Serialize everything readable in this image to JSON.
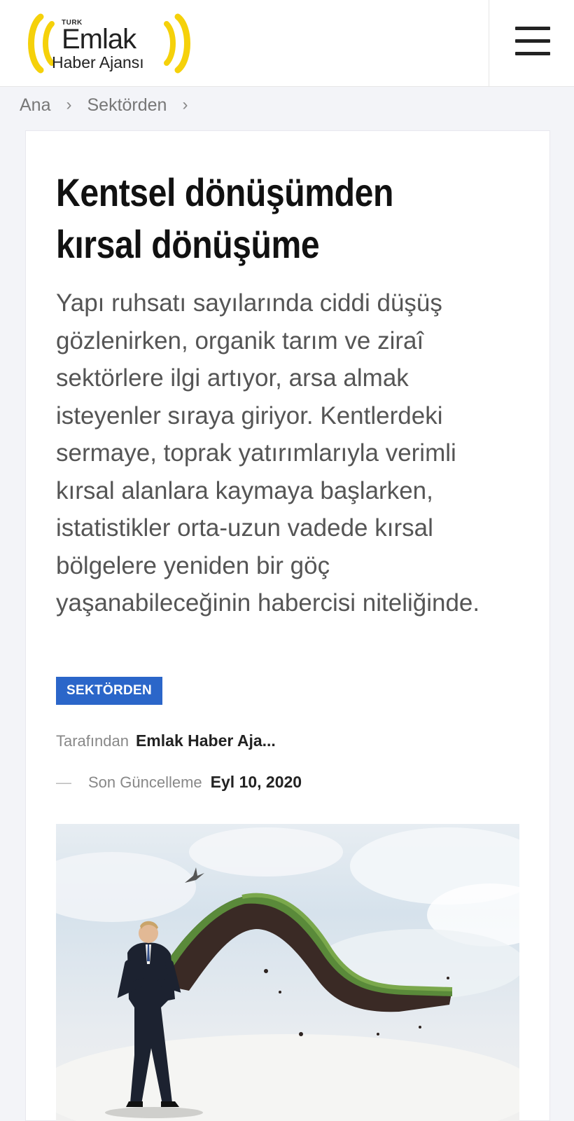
{
  "header": {
    "logo": {
      "turk": "TURK",
      "emlak": "Emlak",
      "haber_ajansi": "Haber Ajansı",
      "accent_color": "#f5d10a"
    },
    "menu_icon": "hamburger-menu-icon"
  },
  "breadcrumb": {
    "items": [
      "Ana",
      "Sektörden"
    ],
    "separator_icon": "chevron-right-icon"
  },
  "article": {
    "title": "Kentsel dönüşümden kırsal dönüşüme",
    "lead": "Yapı ruhsatı sayılarında ciddi düşüş gözlenirken, organik tarım ve ziraî sektörlere ilgi artıyor, arsa almak isteyenler sıraya giriyor. Kentlerdeki sermaye, toprak yatırımlarıyla verimli kırsal alanlara kaymaya başlarken, istatistikler orta-uzun vadede kırsal bölgelere yeniden bir göç yaşanabileceğinin habercisi niteliğinde.",
    "category": "SEKTÖRDEN",
    "category_color": "#2b66c9",
    "byline_label": "Tarafından",
    "author": "Emlak Haber Aja...",
    "updated_label": "Son Güncelleme",
    "updated_date": "Eyl 10, 2020",
    "dash": "—",
    "image_description_icon": "businessman-lifting-grass-carpet-image"
  }
}
